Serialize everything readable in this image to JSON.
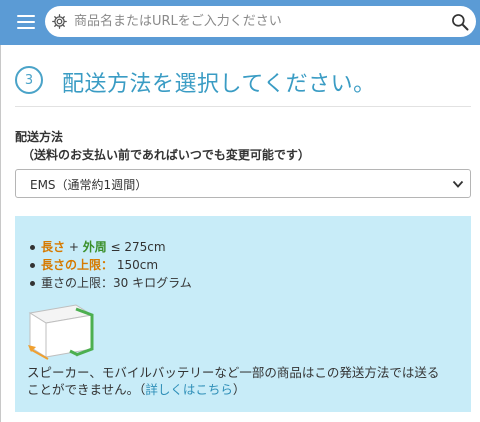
{
  "header": {
    "search_placeholder": "商品名またはURLをご入力ください"
  },
  "step": {
    "number": "3",
    "title": "配送方法を選択してください。"
  },
  "shipping": {
    "label": "配送方法",
    "sublabel": "（送料のお支払い前であればいつでも変更可能です）",
    "selected_option": "EMS（通常約1週間）"
  },
  "info": {
    "size_label_1": "長さ",
    "size_plus": " + ",
    "size_label_2": "外周",
    "size_value": " ≤ 275cm",
    "length_label": "長さの上限：",
    "length_value": " 150cm",
    "weight_text": "重さの上限：30 キログラム",
    "note_text": "スピーカー、モバイルバッテリーなど一部の商品はこの発送方法では送ることができません。（",
    "note_link": "詳しくはこちら",
    "note_end": "）"
  },
  "colors": {
    "header_bg": "#5b9bd5",
    "accent": "#3a9cc4",
    "info_bg": "#c8ecf8",
    "orange": "#d67a00",
    "green": "#3a8f2a"
  }
}
